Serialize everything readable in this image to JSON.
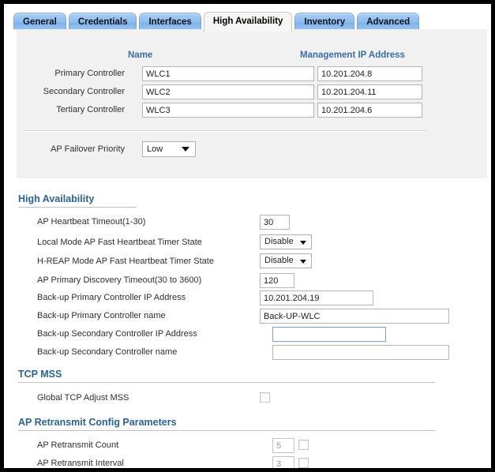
{
  "tabs": [
    {
      "label": "General",
      "active": false
    },
    {
      "label": "Credentials",
      "active": false
    },
    {
      "label": "Interfaces",
      "active": false
    },
    {
      "label": "High Availability",
      "active": true
    },
    {
      "label": "Inventory",
      "active": false
    },
    {
      "label": "Advanced",
      "active": false
    }
  ],
  "controller_table": {
    "headers": {
      "name": "Name",
      "management_ip": "Management IP Address"
    },
    "rows": [
      {
        "label": "Primary Controller",
        "name": "WLC1",
        "ip": "10.201.204.8"
      },
      {
        "label": "Secondary Controller",
        "name": "WLC2",
        "ip": "10.201.204.11"
      },
      {
        "label": "Tertiary Controller",
        "name": "WLC3",
        "ip": "10.201.204.6"
      }
    ]
  },
  "failover": {
    "label": "AP Failover Priority",
    "value": "Low"
  },
  "high_availability": {
    "title": "High Availability",
    "heartbeat_timeout": {
      "label": "AP Heartbeat Timeout(1-30)",
      "value": "30"
    },
    "local_mode_fast_heartbeat": {
      "label": "Local Mode AP Fast Heartbeat Timer State",
      "value": "Disable"
    },
    "hreap_mode_fast_heartbeat": {
      "label": "H-REAP Mode AP Fast Heartbeat Timer State",
      "value": "Disable"
    },
    "primary_discovery_timeout": {
      "label": "AP Primary Discovery Timeout(30 to 3600)",
      "value": "120"
    },
    "backup_primary_ip": {
      "label": "Back-up Primary Controller IP Address",
      "value": "10.201.204.19"
    },
    "backup_primary_name": {
      "label": "Back-up Primary Controller name",
      "value": "Back-UP-WLC"
    },
    "backup_secondary_ip": {
      "label": "Back-up Secondary Controller IP Address",
      "value": ""
    },
    "backup_secondary_name": {
      "label": "Back-up Secondary Controller name",
      "value": ""
    }
  },
  "tcp_mss": {
    "title": "TCP MSS",
    "global_adjust": {
      "label": "Global TCP Adjust MSS",
      "checked": false
    }
  },
  "ap_retransmit": {
    "title": "AP Retransmit Config Parameters",
    "count": {
      "label": "AP Retransmit Count",
      "value": "5",
      "checked": false
    },
    "interval": {
      "label": "AP Retransmit Interval",
      "value": "3",
      "checked": false
    }
  },
  "colors": {
    "tab_active_bg": "#f7f6f4",
    "tab_bg": "#8fbdef",
    "section_title": "#2b6391",
    "column_header": "#3a6ea5",
    "panel_bg": "#f1f1f1"
  }
}
